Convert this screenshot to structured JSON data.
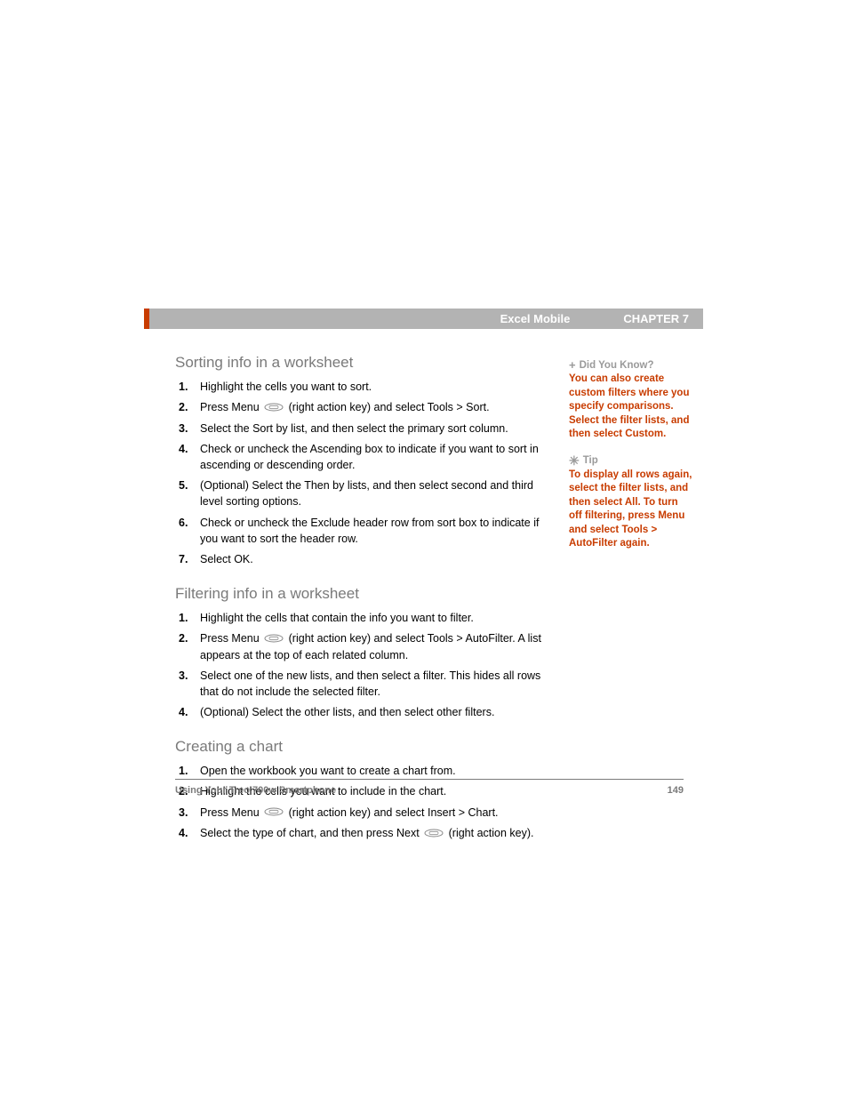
{
  "header": {
    "section": "Excel Mobile",
    "chapter": "CHAPTER 7"
  },
  "sections": [
    {
      "title": "Sorting info in a worksheet",
      "steps": [
        {
          "pre": "Highlight the cells you want to sort."
        },
        {
          "pre": "Press Menu ",
          "icon": true,
          "post": " (right action key) and select Tools > Sort."
        },
        {
          "pre": "Select the Sort by list, and then select the primary sort column."
        },
        {
          "pre": "Check or uncheck the Ascending box to indicate if you want to sort in ascending or descending order."
        },
        {
          "pre": "(Optional) Select the Then by lists, and then select second and third level sorting options."
        },
        {
          "pre": "Check or uncheck the Exclude header row from sort box to indicate if you want to sort the header row."
        },
        {
          "pre": "Select OK."
        }
      ]
    },
    {
      "title": "Filtering info in a worksheet",
      "steps": [
        {
          "pre": "Highlight the cells that contain the info you want to filter."
        },
        {
          "pre": "Press Menu ",
          "icon": true,
          "post": " (right action key) and select Tools > AutoFilter. A list appears at the top of each related column."
        },
        {
          "pre": "Select one of the new lists, and then select a filter. This hides all rows that do not include the selected filter."
        },
        {
          "pre": "(Optional) Select the other lists, and then select other filters."
        }
      ]
    },
    {
      "title": "Creating a chart",
      "steps": [
        {
          "pre": "Open the workbook you want to create a chart from."
        },
        {
          "pre": "Highlight the cells you want to include in the chart."
        },
        {
          "pre": "Press Menu ",
          "icon": true,
          "post": " (right action key) and select Insert > Chart."
        },
        {
          "pre": "Select the type of chart, and then press Next ",
          "icon": true,
          "post": " (right action key)."
        }
      ]
    }
  ],
  "sidebar": [
    {
      "icon": "plus",
      "heading": "Did You Know?",
      "body": "You can also create custom filters where you specify comparisons. Select the filter lists, and then select Custom."
    },
    {
      "icon": "asterisk",
      "heading": "Tip",
      "body": "To display all rows again, select the filter lists, and then select All. To turn off filtering, press Menu and select Tools > AutoFilter again."
    }
  ],
  "footer": {
    "left": "Using Your Treo 700w Smartphone",
    "right": "149"
  }
}
